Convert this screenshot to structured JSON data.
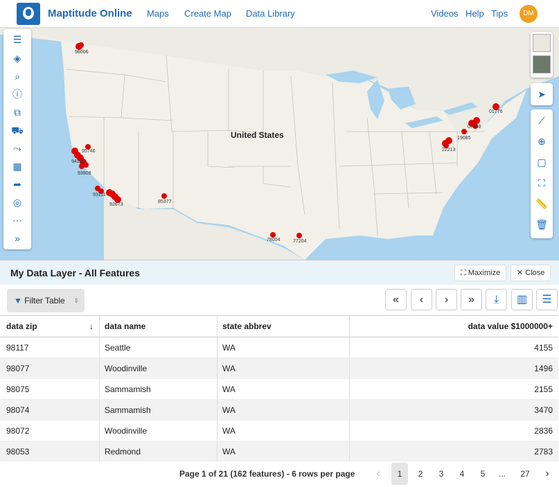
{
  "app": {
    "title": "Maptitude Online",
    "user_initials": "DM"
  },
  "nav": {
    "maps": "Maps",
    "create_map": "Create Map",
    "data_library": "Data Library",
    "videos": "Videos",
    "help": "Help",
    "tips": "Tips"
  },
  "map": {
    "country_label": "United States",
    "zip_labels": [
      "98006",
      "95746",
      "94118",
      "93908",
      "93111",
      "92673",
      "85377",
      "78004",
      "77204",
      "01776",
      "07458",
      "19085",
      "22213"
    ]
  },
  "panel": {
    "title": "My Data Layer - All Features",
    "maximize": "Maximize",
    "close": "Close",
    "filter_table": "Filter Table"
  },
  "table": {
    "columns": [
      "data zip",
      "data name",
      "state abbrev",
      "data value $1000000+"
    ],
    "rows": [
      [
        "98117",
        "Seattle",
        "WA",
        "4155"
      ],
      [
        "98077",
        "Woodinville",
        "WA",
        "1496"
      ],
      [
        "98075",
        "Sammamish",
        "WA",
        "2155"
      ],
      [
        "98074",
        "Sammamish",
        "WA",
        "3470"
      ],
      [
        "98072",
        "Woodinville",
        "WA",
        "2836"
      ],
      [
        "98053",
        "Redmond",
        "WA",
        "2783"
      ]
    ]
  },
  "pager": {
    "info": "Page 1 of 21 (162 features) - 6 rows per page",
    "pages": [
      "1",
      "2",
      "3",
      "4",
      "5",
      "...",
      "27"
    ],
    "current": "1"
  },
  "colors": {
    "accent": "#1e6bb8",
    "marker": "#e00000",
    "water": "#a9d3ee",
    "land": "#ecebe4"
  }
}
